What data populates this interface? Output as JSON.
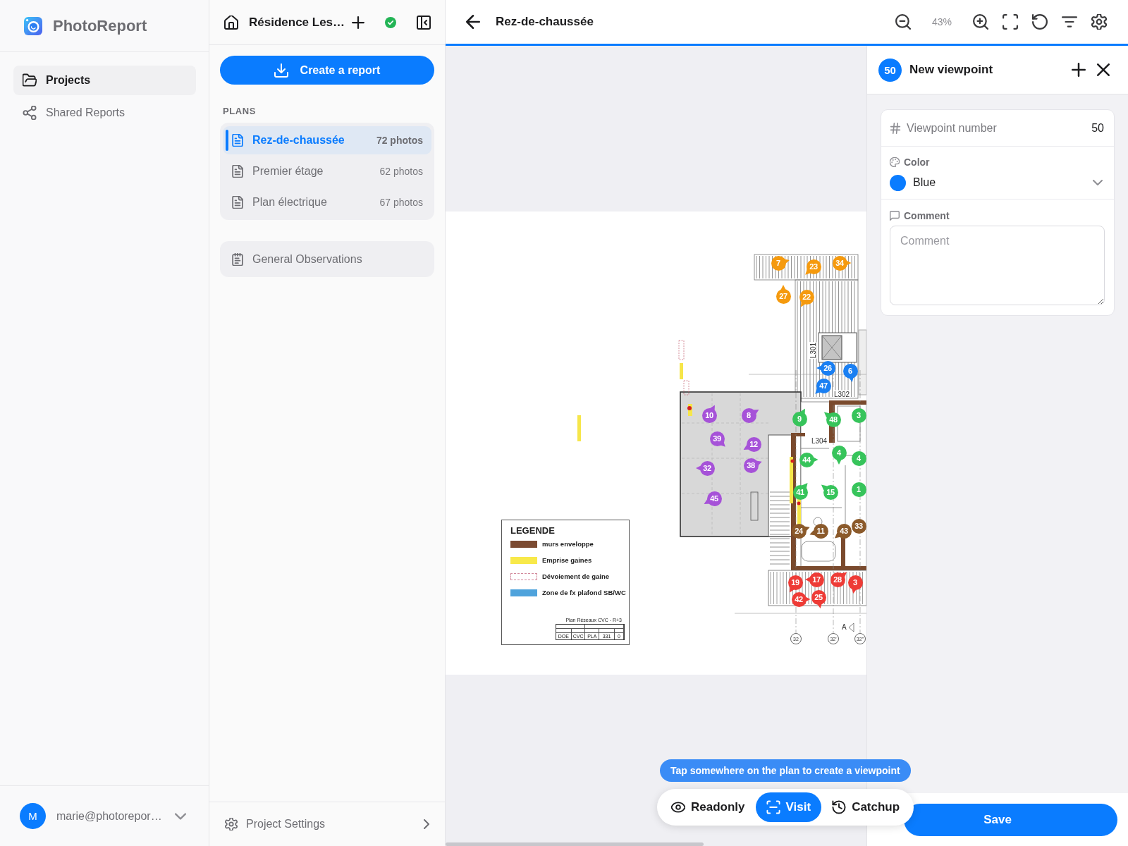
{
  "sidebar": {
    "brand": "PhotoReport",
    "nav": [
      {
        "label": "Projects",
        "selected": true
      },
      {
        "label": "Shared Reports",
        "selected": false
      }
    ],
    "user": {
      "initial": "M",
      "email": "marie@photorepor…"
    }
  },
  "project": {
    "title": "Résidence Les…",
    "create_button": "Create a report",
    "plans_heading": "PLANS",
    "plans": [
      {
        "name": "Rez-de-chaussée",
        "count": "72 photos",
        "selected": true
      },
      {
        "name": "Premier étage",
        "count": "62 photos",
        "selected": false
      },
      {
        "name": "Plan électrique",
        "count": "67 photos",
        "selected": false
      }
    ],
    "observations": "General Observations",
    "settings": "Project Settings"
  },
  "viewer": {
    "title": "Rez-de-chaussée",
    "zoom": "43%",
    "plan": {
      "room_labels": [
        "L301",
        "L302",
        "L304"
      ],
      "grid_axes": [
        "32",
        "32'",
        "32\""
      ],
      "section_mark": "A",
      "legend": {
        "title": "LEGENDE",
        "items": [
          {
            "label": "murs enveloppe",
            "kind": "fill",
            "color": "#7b4a31"
          },
          {
            "label": "Emprise gaines",
            "kind": "fill",
            "color": "#f8e94a"
          },
          {
            "label": "Dévoiement de gaine",
            "kind": "dashed",
            "color": "#d28a9c"
          },
          {
            "label": "Zone de fx plafond SB/WC",
            "kind": "fill",
            "color": "#4fa3dc"
          }
        ]
      },
      "title_block": {
        "title": "Plan Réseaux CVC - R+3",
        "cells": [
          "DOE",
          "CVC",
          "PLA",
          "331",
          "0"
        ]
      },
      "markers": [
        {
          "label": "7",
          "color": "#f59a0e"
        },
        {
          "label": "23",
          "color": "#f59a0e"
        },
        {
          "label": "34",
          "color": "#f59a0e"
        },
        {
          "label": "27",
          "color": "#f59a0e"
        },
        {
          "label": "22",
          "color": "#f59a0e"
        },
        {
          "label": "26",
          "color": "#1a7ff2"
        },
        {
          "label": "6",
          "color": "#1a7ff2"
        },
        {
          "label": "47",
          "color": "#1a7ff2"
        },
        {
          "label": "10",
          "color": "#a652d8"
        },
        {
          "label": "8",
          "color": "#a652d8"
        },
        {
          "label": "9",
          "color": "#37c45b"
        },
        {
          "label": "48",
          "color": "#37c45b"
        },
        {
          "label": "3",
          "color": "#37c45b"
        },
        {
          "label": "39",
          "color": "#a652d8"
        },
        {
          "label": "12",
          "color": "#a652d8"
        },
        {
          "label": "4",
          "color": "#37c45b"
        },
        {
          "label": "4",
          "color": "#37c45b"
        },
        {
          "label": "44",
          "color": "#37c45b"
        },
        {
          "label": "38",
          "color": "#a652d8"
        },
        {
          "label": "32",
          "color": "#a652d8"
        },
        {
          "label": "1",
          "color": "#37c45b"
        },
        {
          "label": "41",
          "color": "#37c45b"
        },
        {
          "label": "15",
          "color": "#37c45b"
        },
        {
          "label": "45",
          "color": "#a652d8"
        },
        {
          "label": "33",
          "color": "#8b5a2b"
        },
        {
          "label": "24",
          "color": "#8b5a2b"
        },
        {
          "label": "11",
          "color": "#8b5a2b"
        },
        {
          "label": "43",
          "color": "#8b5a2b"
        },
        {
          "label": "17",
          "color": "#ee3b36"
        },
        {
          "label": "28",
          "color": "#ee3b36"
        },
        {
          "label": "19",
          "color": "#ee3b36"
        },
        {
          "label": "3",
          "color": "#ee3b36"
        },
        {
          "label": "25",
          "color": "#ee3b36"
        },
        {
          "label": "42",
          "color": "#ee3b36"
        }
      ]
    },
    "hint": "Tap somewhere on the plan to create a viewpoint",
    "modes": [
      {
        "label": "Readonly",
        "selected": false
      },
      {
        "label": "Visit",
        "selected": true
      },
      {
        "label": "Catchup",
        "selected": false
      }
    ]
  },
  "viewpoint": {
    "badge": "50",
    "title": "New viewpoint",
    "number_label": "Viewpoint number",
    "number_value": "50",
    "color_label": "Color",
    "color_name": "Blue",
    "color": "#0a7cff",
    "comment_label": "Comment",
    "comment_placeholder": "Comment",
    "save_button": "Save"
  }
}
